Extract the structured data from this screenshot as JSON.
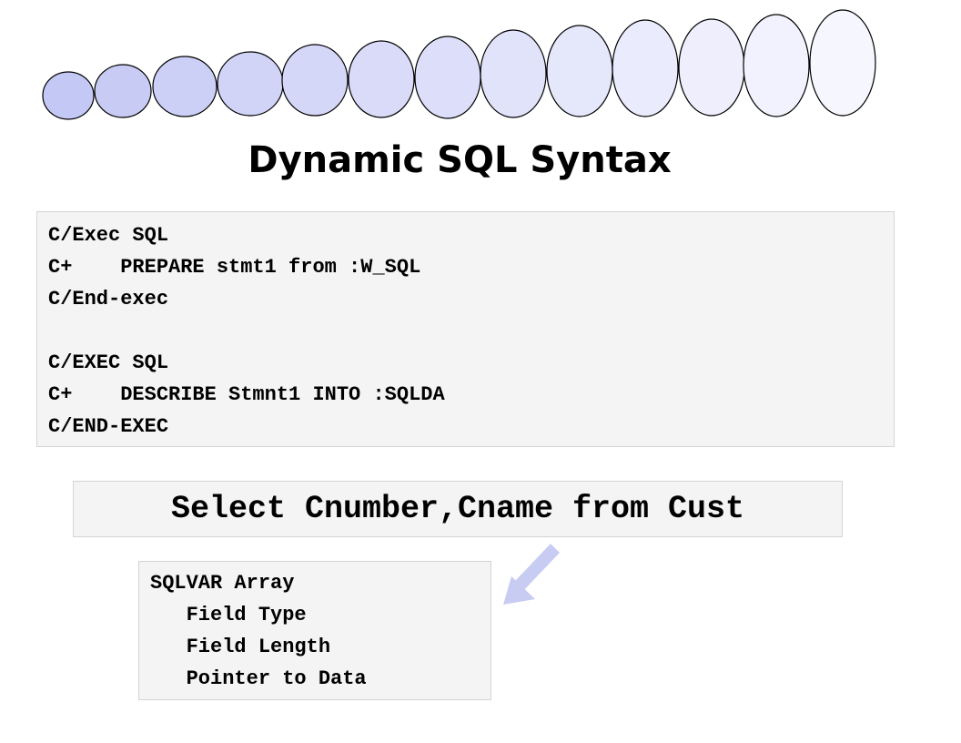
{
  "slide": {
    "title": "Dynamic SQL Syntax"
  },
  "code_block": {
    "lines": [
      "C/Exec SQL",
      "C+    PREPARE stmt1 from :W_SQL",
      "C/End-exec",
      "",
      "C/EXEC SQL",
      "C+    DESCRIBE Stmnt1 INTO :SQLDA",
      "C/END-EXEC"
    ]
  },
  "query": {
    "text": "Select Cnumber,Cname from Cust"
  },
  "sqlvar": {
    "lines": [
      "SQLVAR Array",
      "   Field Type",
      "   Field Length",
      "   Pointer to Data"
    ]
  },
  "colors": {
    "oval_dark": "#c4c8f4",
    "oval_light": "#f6f6ff",
    "arrow": "#c8ccf2",
    "box_background": "#f4f4f4"
  },
  "icons": {
    "decoration": "ovals-decoration-icon",
    "arrow": "arrow-down-left-icon"
  }
}
